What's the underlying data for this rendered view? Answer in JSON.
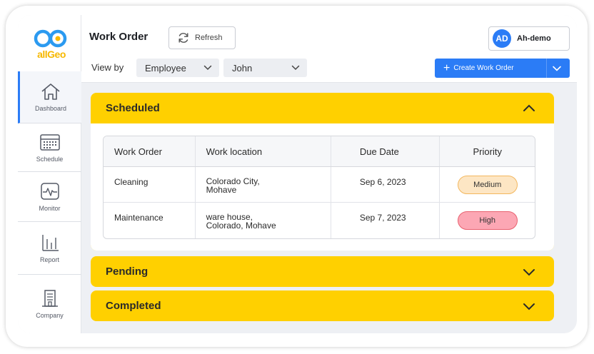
{
  "brand": {
    "logo_text": "allGeo",
    "colors": {
      "primary": "#2b7cf6",
      "accent": "#ffd000",
      "logo_ring_blue": "#2b9af0",
      "logo_ring_yellow": "#f6b800"
    }
  },
  "sidebar": {
    "items": [
      {
        "label": "Dashboard",
        "icon": "home-icon",
        "active": true
      },
      {
        "label": "Schedule",
        "icon": "calendar-icon",
        "active": false
      },
      {
        "label": "Monitor",
        "icon": "monitor-icon",
        "active": false
      },
      {
        "label": "Report",
        "icon": "bar-chart-icon",
        "active": false
      },
      {
        "label": "Company",
        "icon": "building-icon",
        "active": false
      }
    ]
  },
  "header": {
    "title": "Work Order",
    "refresh_label": "Refresh",
    "user": {
      "initials": "AD",
      "name": "Ah-demo"
    },
    "view_by_label": "View by",
    "filters": {
      "view_by_value": "Employee",
      "employee_value": "John"
    },
    "create_label": "Create Work Order"
  },
  "sections": [
    {
      "title": "Scheduled",
      "expanded": true
    },
    {
      "title": "Pending",
      "expanded": false
    },
    {
      "title": "Completed",
      "expanded": false
    }
  ],
  "table": {
    "columns": [
      "Work Order",
      "Work location",
      "Due Date",
      "Priority"
    ],
    "rows": [
      {
        "work_order": "Cleaning",
        "location": "Colorado City,\nMohave",
        "due": "Sep 6, 2023",
        "priority": "Medium",
        "priority_bg": "#fde6c4",
        "priority_border": "#f3b75e"
      },
      {
        "work_order": "Maintenance",
        "location": "ware house,\nColorado, Mohave",
        "due": "Sep 7, 2023",
        "priority": "High",
        "priority_bg": "#fca7b4",
        "priority_border": "#e8616f"
      }
    ]
  }
}
